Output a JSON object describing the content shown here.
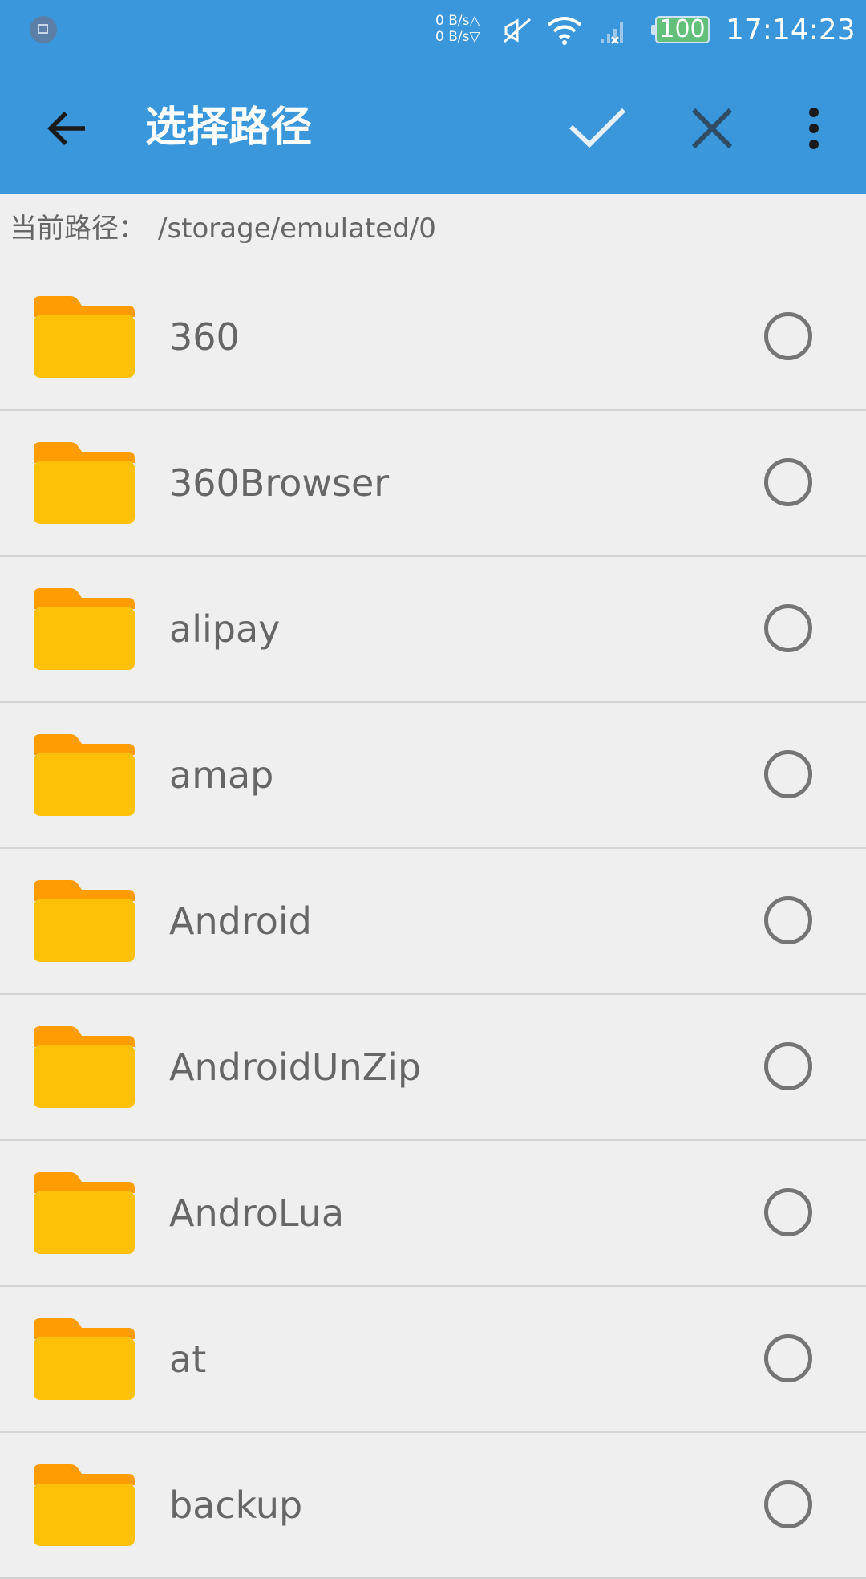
{
  "status_bar": {
    "net_up": "0 B/s△",
    "net_down": "0 B/s▽",
    "battery": "100",
    "time": "17:14:23"
  },
  "app_bar": {
    "title": "选择路径",
    "icons": [
      "back-arrow-icon",
      "check-icon",
      "close-icon",
      "more-vert-icon"
    ]
  },
  "path_bar": {
    "label": "当前路径：",
    "value": "/storage/emulated/0"
  },
  "colors": {
    "primary": "#3a97db",
    "folder": "#ffc107",
    "folder_tab": "#ff9c00",
    "background": "#efefef"
  },
  "folders": [
    {
      "name": "360",
      "selected": false
    },
    {
      "name": "360Browser",
      "selected": false
    },
    {
      "name": "alipay",
      "selected": false
    },
    {
      "name": "amap",
      "selected": false
    },
    {
      "name": "Android",
      "selected": false
    },
    {
      "name": "AndroidUnZip",
      "selected": false
    },
    {
      "name": "AndroLua",
      "selected": false
    },
    {
      "name": "at",
      "selected": false
    },
    {
      "name": "backup",
      "selected": false
    }
  ]
}
